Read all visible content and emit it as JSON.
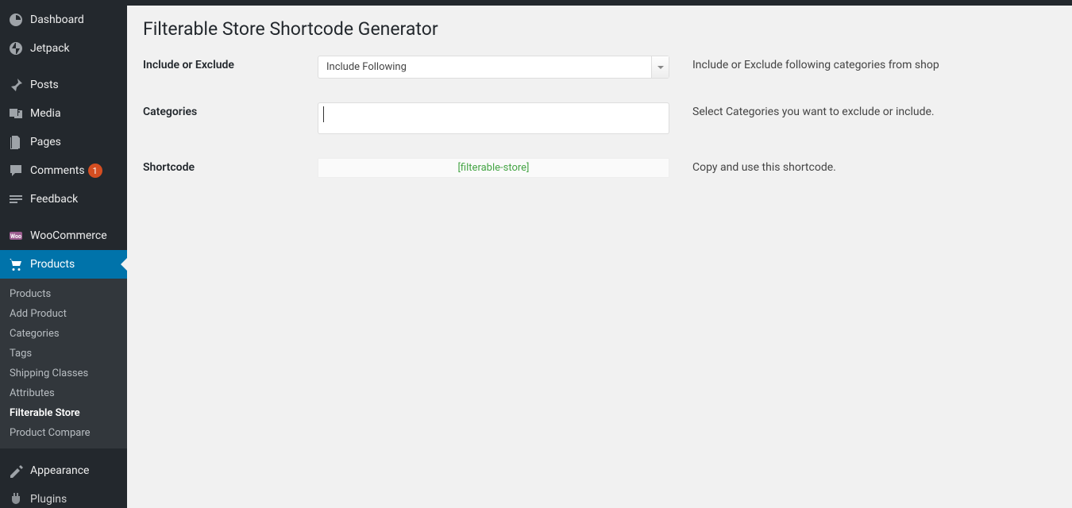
{
  "page": {
    "title": "Filterable Store Shortcode Generator"
  },
  "sidebar": {
    "items": [
      {
        "label": "Dashboard",
        "icon": "dashboard-icon"
      },
      {
        "label": "Jetpack",
        "icon": "jetpack-icon"
      },
      {
        "label": "Posts",
        "icon": "pin-icon"
      },
      {
        "label": "Media",
        "icon": "media-icon"
      },
      {
        "label": "Pages",
        "icon": "pages-icon"
      },
      {
        "label": "Comments",
        "icon": "comment-icon",
        "badge": "1"
      },
      {
        "label": "Feedback",
        "icon": "feedback-icon"
      },
      {
        "label": "WooCommerce",
        "icon": "woocommerce-icon"
      },
      {
        "label": "Products",
        "icon": "cart-icon"
      },
      {
        "label": "Appearance",
        "icon": "appearance-icon"
      },
      {
        "label": "Plugins",
        "icon": "plugins-icon"
      }
    ],
    "submenu": [
      {
        "label": "Products"
      },
      {
        "label": "Add Product"
      },
      {
        "label": "Categories"
      },
      {
        "label": "Tags"
      },
      {
        "label": "Shipping Classes"
      },
      {
        "label": "Attributes"
      },
      {
        "label": "Filterable Store"
      },
      {
        "label": "Product Compare"
      }
    ]
  },
  "form": {
    "include_exclude": {
      "label": "Include or Exclude",
      "value": "Include Following",
      "help": "Include or Exclude following categories from shop"
    },
    "categories": {
      "label": "Categories",
      "help": "Select Categories you want to exclude or include."
    },
    "shortcode": {
      "label": "Shortcode",
      "value": "[filterable-store]",
      "help": "Copy and use this shortcode."
    }
  }
}
